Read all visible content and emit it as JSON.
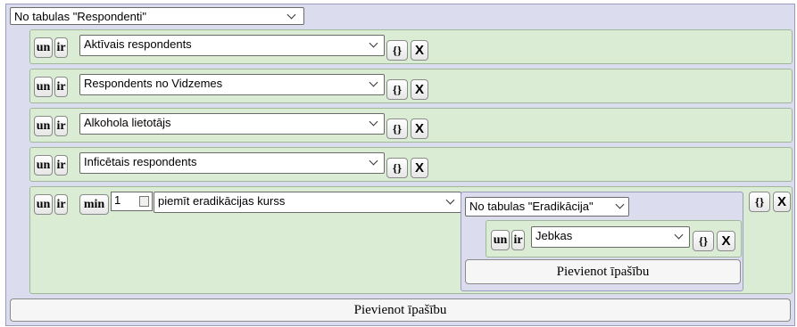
{
  "top_select": {
    "value": "No tabulas \"Respondenti\""
  },
  "rows": [
    {
      "un": "un",
      "ir": "ir",
      "value": "Aktīvais respondents",
      "braces": "{}",
      "x": "X"
    },
    {
      "un": "un",
      "ir": "ir",
      "value": "Respondents no Vidzemes",
      "braces": "{}",
      "x": "X"
    },
    {
      "un": "un",
      "ir": "ir",
      "value": "Alkohola lietotājs",
      "braces": "{}",
      "x": "X"
    },
    {
      "un": "un",
      "ir": "ir",
      "value": "Inficētais respondents",
      "braces": "{}",
      "x": "X"
    }
  ],
  "complex_row": {
    "un": "un",
    "ir": "ir",
    "min": "min",
    "count": "1",
    "value": "piemīt eradikācijas kurss",
    "braces": "{}",
    "x": "X",
    "nested": {
      "select": "No tabulas \"Eradikācija\"",
      "row": {
        "un": "un",
        "ir": "ir",
        "value": "Jebkas",
        "braces": "{}",
        "x": "X"
      },
      "add_label": "Pievienot īpašību"
    }
  },
  "add_label": "Pievienot īpašību"
}
